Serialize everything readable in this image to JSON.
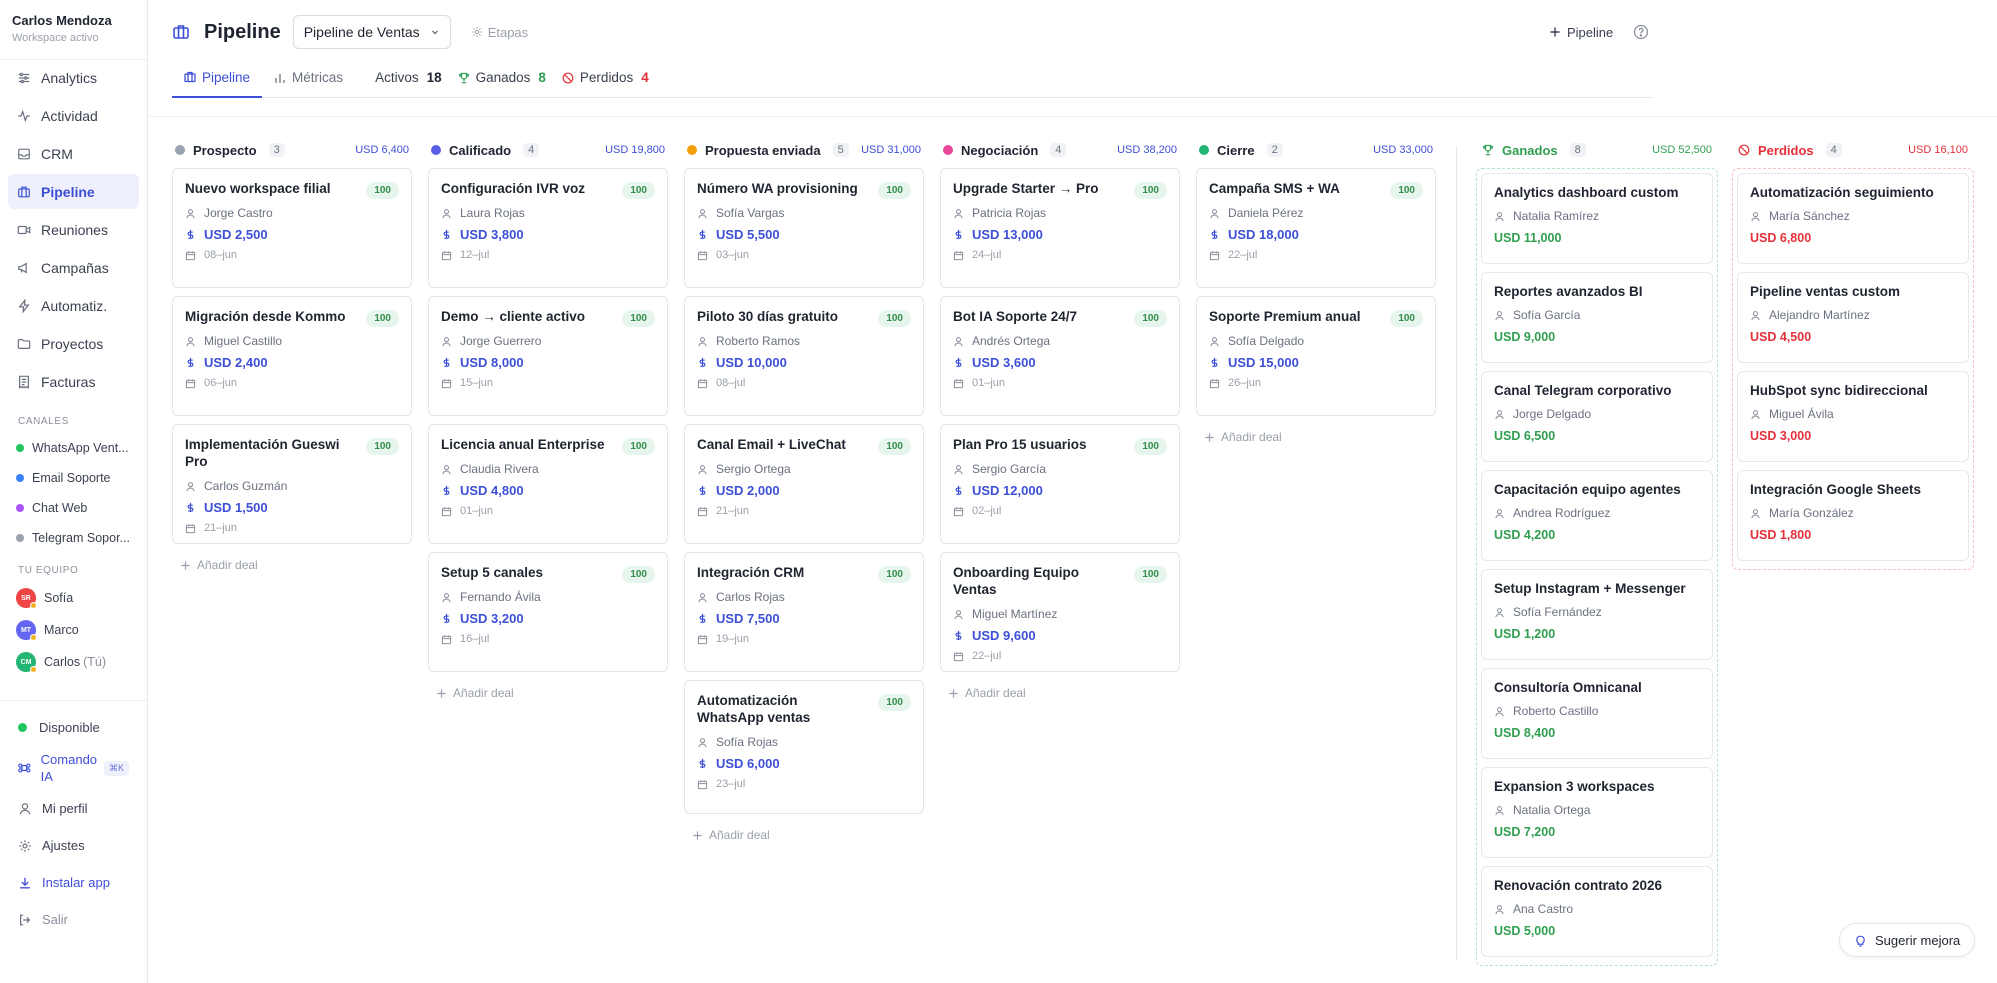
{
  "workspace": {
    "name": "Carlos Mendoza",
    "subtitle": "Workspace activo"
  },
  "nav": [
    {
      "label": "Analytics",
      "icon": "sliders-icon"
    },
    {
      "label": "Actividad",
      "icon": "activity-icon"
    },
    {
      "label": "CRM",
      "icon": "inbox-icon"
    },
    {
      "label": "Pipeline",
      "icon": "briefcase-icon",
      "active": true
    },
    {
      "label": "Reuniones",
      "icon": "video-icon"
    },
    {
      "label": "Campañas",
      "icon": "megaphone-icon"
    },
    {
      "label": "Automatiz.",
      "icon": "zap-icon"
    },
    {
      "label": "Proyectos",
      "icon": "folder-icon"
    },
    {
      "label": "Facturas",
      "icon": "receipt-icon"
    }
  ],
  "channels_title": "CANALES",
  "channels": [
    {
      "label": "WhatsApp Vent...",
      "color": "#22c55e"
    },
    {
      "label": "Email Soporte",
      "color": "#3b82f6"
    },
    {
      "label": "Chat Web",
      "color": "#a855f7"
    },
    {
      "label": "Telegram Sopor...",
      "color": "#9ca3af"
    }
  ],
  "team_title": "TU EQUIPO",
  "team": [
    {
      "initials": "SR",
      "name": "Sofía",
      "color": "#ef4444",
      "you": ""
    },
    {
      "initials": "MT",
      "name": "Marco",
      "color": "#6366f1",
      "you": ""
    },
    {
      "initials": "CM",
      "name": "Carlos",
      "color": "#22b573",
      "you": "(Tú)"
    }
  ],
  "bottom": {
    "status": "Disponible",
    "status_color": "#22c55e",
    "command": "Comando IA",
    "command_kbd": "⌘K",
    "profile": "Mi perfil",
    "settings": "Ajustes",
    "install": "Instalar app",
    "logout": "Salir"
  },
  "header": {
    "title": "Pipeline",
    "pipeline_select": "Pipeline de Ventas",
    "stages": "Etapas",
    "add_pipeline": "Pipeline"
  },
  "tabs": {
    "pipeline": "Pipeline",
    "metrics": "Métricas"
  },
  "stats": {
    "active_label": "Activos",
    "active_count": "18",
    "won_label": "Ganados",
    "won_count": "8",
    "lost_label": "Perdidos",
    "lost_count": "4"
  },
  "add_deal_label": "Añadir deal",
  "columns": [
    {
      "name": "Prospecto",
      "count": "3",
      "total": "USD 6,400",
      "color": "#9aa3b2",
      "deals": [
        {
          "title": "Nuevo workspace filial",
          "score": "100",
          "owner": "Jorge Castro",
          "amount": "USD 2,500",
          "date": "08–jun"
        },
        {
          "title": "Migración desde Kommo",
          "score": "100",
          "owner": "Miguel Castillo",
          "amount": "USD 2,400",
          "date": "06–jun"
        },
        {
          "title": "Implementación Gueswi Pro",
          "score": "100",
          "owner": "Carlos Guzmán",
          "amount": "USD 1,500",
          "date": "21–jun"
        }
      ]
    },
    {
      "name": "Calificado",
      "count": "4",
      "total": "USD 19,800",
      "color": "#5b5ee6",
      "deals": [
        {
          "title": "Configuración IVR voz",
          "score": "100",
          "owner": "Laura Rojas",
          "amount": "USD 3,800",
          "date": "12–jul"
        },
        {
          "title": "Demo → cliente activo",
          "score": "100",
          "owner": "Jorge Guerrero",
          "amount": "USD 8,000",
          "date": "15–jun"
        },
        {
          "title": "Licencia anual Enterprise",
          "score": "100",
          "owner": "Claudia Rivera",
          "amount": "USD 4,800",
          "date": "01–jun"
        },
        {
          "title": "Setup 5 canales",
          "score": "100",
          "owner": "Fernando Ávila",
          "amount": "USD 3,200",
          "date": "16–jul"
        }
      ]
    },
    {
      "name": "Propuesta enviada",
      "count": "5",
      "total": "USD 31,000",
      "color": "#f59e0b",
      "deals": [
        {
          "title": "Número WA provisioning",
          "score": "100",
          "owner": "Sofía Vargas",
          "amount": "USD 5,500",
          "date": "03–jun"
        },
        {
          "title": "Piloto 30 días gratuito",
          "score": "100",
          "owner": "Roberto Ramos",
          "amount": "USD 10,000",
          "date": "08–jul"
        },
        {
          "title": "Canal Email + LiveChat",
          "score": "100",
          "owner": "Sergio Ortega",
          "amount": "USD 2,000",
          "date": "21–jun"
        },
        {
          "title": "Integración CRM",
          "score": "100",
          "owner": "Carlos Rojas",
          "amount": "USD 7,500",
          "date": "19–jun"
        },
        {
          "title": "Automatización WhatsApp ventas",
          "score": "100",
          "owner": "Sofía Rojas",
          "amount": "USD 6,000",
          "date": "23–jul"
        }
      ]
    },
    {
      "name": "Negociación",
      "count": "4",
      "total": "USD 38,200",
      "color": "#ec4899",
      "deals": [
        {
          "title": "Upgrade Starter → Pro",
          "score": "100",
          "owner": "Patricia Rojas",
          "amount": "USD 13,000",
          "date": "24–jul"
        },
        {
          "title": "Bot IA Soporte 24/7",
          "score": "100",
          "owner": "Andrés Ortega",
          "amount": "USD 3,600",
          "date": "01–jun"
        },
        {
          "title": "Plan Pro 15 usuarios",
          "score": "100",
          "owner": "Sergio García",
          "amount": "USD 12,000",
          "date": "02–jul"
        },
        {
          "title": "Onboarding Equipo Ventas",
          "score": "100",
          "owner": "Miguel Martínez",
          "amount": "USD 9,600",
          "date": "22–jul"
        }
      ]
    },
    {
      "name": "Cierre",
      "count": "2",
      "total": "USD 33,000",
      "color": "#22b573",
      "deals": [
        {
          "title": "Campaña SMS + WA",
          "score": "100",
          "owner": "Daniela Pérez",
          "amount": "USD 18,000",
          "date": "22–jul"
        },
        {
          "title": "Soporte Premium anual",
          "score": "100",
          "owner": "Sofía Delgado",
          "amount": "USD 15,000",
          "date": "26–jun"
        }
      ]
    }
  ],
  "won": {
    "name": "Ganados",
    "count": "8",
    "total": "USD 52,500",
    "deals": [
      {
        "title": "Analytics dashboard custom",
        "owner": "Natalia Ramírez",
        "amount": "USD 11,000"
      },
      {
        "title": "Reportes avanzados BI",
        "owner": "Sofía García",
        "amount": "USD 9,000"
      },
      {
        "title": "Canal Telegram corporativo",
        "owner": "Jorge Delgado",
        "amount": "USD 6,500"
      },
      {
        "title": "Capacitación equipo agentes",
        "owner": "Andrea Rodríguez",
        "amount": "USD 4,200"
      },
      {
        "title": "Setup Instagram + Messenger",
        "owner": "Sofía Fernández",
        "amount": "USD 1,200"
      },
      {
        "title": "Consultoría Omnicanal",
        "owner": "Roberto Castillo",
        "amount": "USD 8,400"
      },
      {
        "title": "Expansion 3 workspaces",
        "owner": "Natalia Ortega",
        "amount": "USD 7,200"
      },
      {
        "title": "Renovación contrato 2026",
        "owner": "Ana Castro",
        "amount": "USD 5,000"
      }
    ]
  },
  "lost": {
    "name": "Perdidos",
    "count": "4",
    "total": "USD 16,100",
    "deals": [
      {
        "title": "Automatización seguimiento",
        "owner": "María Sánchez",
        "amount": "USD 6,800"
      },
      {
        "title": "Pipeline ventas custom",
        "owner": "Alejandro Martínez",
        "amount": "USD 4,500"
      },
      {
        "title": "HubSpot sync bidireccional",
        "owner": "Miguel Ávila",
        "amount": "USD 3,000"
      },
      {
        "title": "Integración Google Sheets",
        "owner": "María González",
        "amount": "USD 1,800"
      }
    ]
  },
  "suggest_label": "Sugerir mejora"
}
